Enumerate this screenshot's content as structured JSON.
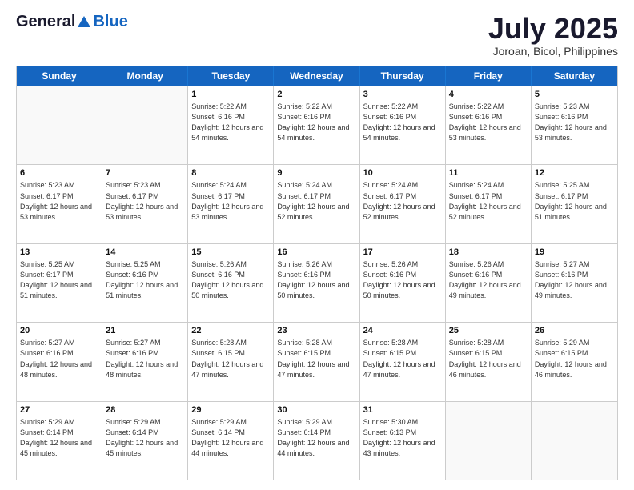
{
  "header": {
    "logo_general": "General",
    "logo_blue": "Blue",
    "main_title": "July 2025",
    "subtitle": "Joroan, Bicol, Philippines"
  },
  "calendar": {
    "days_of_week": [
      "Sunday",
      "Monday",
      "Tuesday",
      "Wednesday",
      "Thursday",
      "Friday",
      "Saturday"
    ],
    "weeks": [
      [
        {
          "day": "",
          "sunrise": "",
          "sunset": "",
          "daylight": "",
          "empty": true
        },
        {
          "day": "",
          "sunrise": "",
          "sunset": "",
          "daylight": "",
          "empty": true
        },
        {
          "day": "1",
          "sunrise": "Sunrise: 5:22 AM",
          "sunset": "Sunset: 6:16 PM",
          "daylight": "Daylight: 12 hours and 54 minutes.",
          "empty": false
        },
        {
          "day": "2",
          "sunrise": "Sunrise: 5:22 AM",
          "sunset": "Sunset: 6:16 PM",
          "daylight": "Daylight: 12 hours and 54 minutes.",
          "empty": false
        },
        {
          "day": "3",
          "sunrise": "Sunrise: 5:22 AM",
          "sunset": "Sunset: 6:16 PM",
          "daylight": "Daylight: 12 hours and 54 minutes.",
          "empty": false
        },
        {
          "day": "4",
          "sunrise": "Sunrise: 5:22 AM",
          "sunset": "Sunset: 6:16 PM",
          "daylight": "Daylight: 12 hours and 53 minutes.",
          "empty": false
        },
        {
          "day": "5",
          "sunrise": "Sunrise: 5:23 AM",
          "sunset": "Sunset: 6:16 PM",
          "daylight": "Daylight: 12 hours and 53 minutes.",
          "empty": false
        }
      ],
      [
        {
          "day": "6",
          "sunrise": "Sunrise: 5:23 AM",
          "sunset": "Sunset: 6:17 PM",
          "daylight": "Daylight: 12 hours and 53 minutes.",
          "empty": false
        },
        {
          "day": "7",
          "sunrise": "Sunrise: 5:23 AM",
          "sunset": "Sunset: 6:17 PM",
          "daylight": "Daylight: 12 hours and 53 minutes.",
          "empty": false
        },
        {
          "day": "8",
          "sunrise": "Sunrise: 5:24 AM",
          "sunset": "Sunset: 6:17 PM",
          "daylight": "Daylight: 12 hours and 53 minutes.",
          "empty": false
        },
        {
          "day": "9",
          "sunrise": "Sunrise: 5:24 AM",
          "sunset": "Sunset: 6:17 PM",
          "daylight": "Daylight: 12 hours and 52 minutes.",
          "empty": false
        },
        {
          "day": "10",
          "sunrise": "Sunrise: 5:24 AM",
          "sunset": "Sunset: 6:17 PM",
          "daylight": "Daylight: 12 hours and 52 minutes.",
          "empty": false
        },
        {
          "day": "11",
          "sunrise": "Sunrise: 5:24 AM",
          "sunset": "Sunset: 6:17 PM",
          "daylight": "Daylight: 12 hours and 52 minutes.",
          "empty": false
        },
        {
          "day": "12",
          "sunrise": "Sunrise: 5:25 AM",
          "sunset": "Sunset: 6:17 PM",
          "daylight": "Daylight: 12 hours and 51 minutes.",
          "empty": false
        }
      ],
      [
        {
          "day": "13",
          "sunrise": "Sunrise: 5:25 AM",
          "sunset": "Sunset: 6:17 PM",
          "daylight": "Daylight: 12 hours and 51 minutes.",
          "empty": false
        },
        {
          "day": "14",
          "sunrise": "Sunrise: 5:25 AM",
          "sunset": "Sunset: 6:16 PM",
          "daylight": "Daylight: 12 hours and 51 minutes.",
          "empty": false
        },
        {
          "day": "15",
          "sunrise": "Sunrise: 5:26 AM",
          "sunset": "Sunset: 6:16 PM",
          "daylight": "Daylight: 12 hours and 50 minutes.",
          "empty": false
        },
        {
          "day": "16",
          "sunrise": "Sunrise: 5:26 AM",
          "sunset": "Sunset: 6:16 PM",
          "daylight": "Daylight: 12 hours and 50 minutes.",
          "empty": false
        },
        {
          "day": "17",
          "sunrise": "Sunrise: 5:26 AM",
          "sunset": "Sunset: 6:16 PM",
          "daylight": "Daylight: 12 hours and 50 minutes.",
          "empty": false
        },
        {
          "day": "18",
          "sunrise": "Sunrise: 5:26 AM",
          "sunset": "Sunset: 6:16 PM",
          "daylight": "Daylight: 12 hours and 49 minutes.",
          "empty": false
        },
        {
          "day": "19",
          "sunrise": "Sunrise: 5:27 AM",
          "sunset": "Sunset: 6:16 PM",
          "daylight": "Daylight: 12 hours and 49 minutes.",
          "empty": false
        }
      ],
      [
        {
          "day": "20",
          "sunrise": "Sunrise: 5:27 AM",
          "sunset": "Sunset: 6:16 PM",
          "daylight": "Daylight: 12 hours and 48 minutes.",
          "empty": false
        },
        {
          "day": "21",
          "sunrise": "Sunrise: 5:27 AM",
          "sunset": "Sunset: 6:16 PM",
          "daylight": "Daylight: 12 hours and 48 minutes.",
          "empty": false
        },
        {
          "day": "22",
          "sunrise": "Sunrise: 5:28 AM",
          "sunset": "Sunset: 6:15 PM",
          "daylight": "Daylight: 12 hours and 47 minutes.",
          "empty": false
        },
        {
          "day": "23",
          "sunrise": "Sunrise: 5:28 AM",
          "sunset": "Sunset: 6:15 PM",
          "daylight": "Daylight: 12 hours and 47 minutes.",
          "empty": false
        },
        {
          "day": "24",
          "sunrise": "Sunrise: 5:28 AM",
          "sunset": "Sunset: 6:15 PM",
          "daylight": "Daylight: 12 hours and 47 minutes.",
          "empty": false
        },
        {
          "day": "25",
          "sunrise": "Sunrise: 5:28 AM",
          "sunset": "Sunset: 6:15 PM",
          "daylight": "Daylight: 12 hours and 46 minutes.",
          "empty": false
        },
        {
          "day": "26",
          "sunrise": "Sunrise: 5:29 AM",
          "sunset": "Sunset: 6:15 PM",
          "daylight": "Daylight: 12 hours and 46 minutes.",
          "empty": false
        }
      ],
      [
        {
          "day": "27",
          "sunrise": "Sunrise: 5:29 AM",
          "sunset": "Sunset: 6:14 PM",
          "daylight": "Daylight: 12 hours and 45 minutes.",
          "empty": false
        },
        {
          "day": "28",
          "sunrise": "Sunrise: 5:29 AM",
          "sunset": "Sunset: 6:14 PM",
          "daylight": "Daylight: 12 hours and 45 minutes.",
          "empty": false
        },
        {
          "day": "29",
          "sunrise": "Sunrise: 5:29 AM",
          "sunset": "Sunset: 6:14 PM",
          "daylight": "Daylight: 12 hours and 44 minutes.",
          "empty": false
        },
        {
          "day": "30",
          "sunrise": "Sunrise: 5:29 AM",
          "sunset": "Sunset: 6:14 PM",
          "daylight": "Daylight: 12 hours and 44 minutes.",
          "empty": false
        },
        {
          "day": "31",
          "sunrise": "Sunrise: 5:30 AM",
          "sunset": "Sunset: 6:13 PM",
          "daylight": "Daylight: 12 hours and 43 minutes.",
          "empty": false
        },
        {
          "day": "",
          "sunrise": "",
          "sunset": "",
          "daylight": "",
          "empty": true
        },
        {
          "day": "",
          "sunrise": "",
          "sunset": "",
          "daylight": "",
          "empty": true
        }
      ]
    ]
  }
}
